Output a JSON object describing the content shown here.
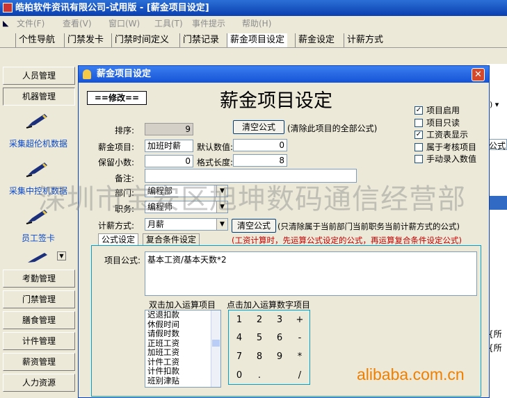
{
  "window": {
    "title": "皓柏软件资讯有限公司-试用版 - [薪金项目设定]"
  },
  "menu": {
    "items": [
      "文件(F)",
      "查看(V)",
      "窗口(W)",
      "工具(T)",
      "事件提示",
      "帮助(H)"
    ]
  },
  "tabs": [
    "个性导航",
    "门禁发卡",
    "门禁时间定义",
    "门禁记录",
    "薪金项目设定",
    "薪金设定",
    "计薪方式"
  ],
  "sidebar": {
    "top_buttons": [
      "人员管理",
      "机器管理"
    ],
    "shortcuts": [
      "采集超伦机数据",
      "采集中控机数据",
      "员工签卡"
    ],
    "bottom_buttons": [
      "考勤管理",
      "门禁管理",
      "膳食管理",
      "计件管理",
      "薪资管理",
      "人力资源"
    ]
  },
  "dialog": {
    "title": "薪金项目设定",
    "mode": "==修改==",
    "heading": "薪金项目设定",
    "clear_formula_btn": "清空公式",
    "clear_formula_note": "(清除此项目的全部公式)",
    "fields": {
      "order_label": "排序:",
      "order_value": "9",
      "item_label": "薪金项目:",
      "item_value": "加班时薪",
      "default_label": "默认数值:",
      "default_value": "0",
      "decimals_label": "保留小数:",
      "decimals_value": "0",
      "format_len_label": "格式长度:",
      "format_len_value": "8",
      "note_label": "备注:",
      "note_value": "",
      "dept_label": "部门:",
      "dept_value": "编程部",
      "job_label": "职务:",
      "job_value": "编程师",
      "pay_method_label": "计薪方式:",
      "pay_method_value": "月薪"
    },
    "clear_formula_btn2": "清空公式",
    "clear_formula_note2": "(只清除属于当前部门当前职务当前计薪方式的公式)",
    "checkboxes": [
      {
        "label": "项目启用",
        "checked": true
      },
      {
        "label": "项目只读",
        "checked": false
      },
      {
        "label": "工资表显示",
        "checked": true
      },
      {
        "label": "属于考核项目",
        "checked": false
      },
      {
        "label": "手动录入数值",
        "checked": false
      }
    ],
    "subtabs": [
      "公式设定",
      "复合条件设定"
    ],
    "calc_note": "(工资计算时，先运算公式设定的公式，再运算复合条件设定公式)",
    "formula_label": "项目公式:",
    "formula_value": "基本工资/基本天数*2",
    "list_caption": "双击加入运算项目",
    "list_items": [
      "迟退扣款",
      "休假时间",
      "请假时数",
      "正班工资",
      "加班工资",
      "计件工资",
      "计件扣款",
      "班别津贴"
    ],
    "keypad_caption": "点击加入运算数字项目",
    "keypad": [
      "1",
      "2",
      "3",
      "+",
      "4",
      "5",
      "6",
      "-",
      "7",
      "8",
      "9",
      "*",
      "0",
      ".",
      "",
      "/"
    ]
  },
  "background": {
    "field_label": "公式",
    "rows": [
      "{所",
      "{所"
    ]
  },
  "watermark": "深圳市宝安区旭坤数码通信经营部",
  "brand": "alibaba.com.cn"
}
